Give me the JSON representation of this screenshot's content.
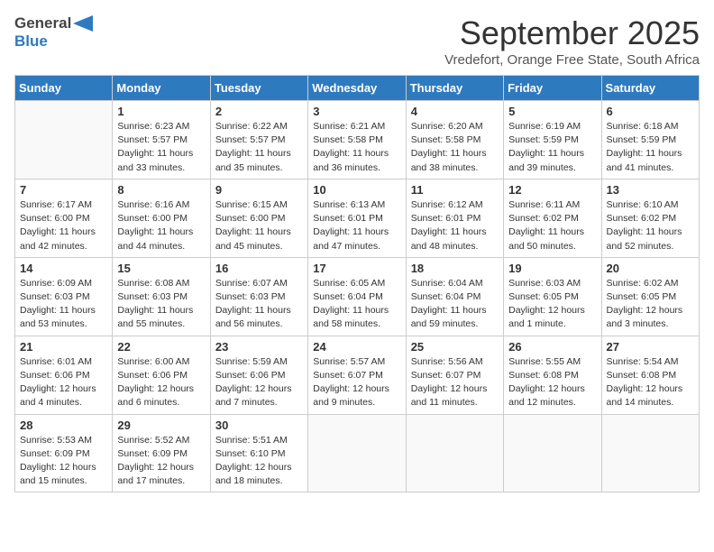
{
  "header": {
    "logo_general": "General",
    "logo_blue": "Blue",
    "month_title": "September 2025",
    "subtitle": "Vredefort, Orange Free State, South Africa"
  },
  "days_of_week": [
    "Sunday",
    "Monday",
    "Tuesday",
    "Wednesday",
    "Thursday",
    "Friday",
    "Saturday"
  ],
  "weeks": [
    [
      {
        "day": "",
        "info": ""
      },
      {
        "day": "1",
        "info": "Sunrise: 6:23 AM\nSunset: 5:57 PM\nDaylight: 11 hours\nand 33 minutes."
      },
      {
        "day": "2",
        "info": "Sunrise: 6:22 AM\nSunset: 5:57 PM\nDaylight: 11 hours\nand 35 minutes."
      },
      {
        "day": "3",
        "info": "Sunrise: 6:21 AM\nSunset: 5:58 PM\nDaylight: 11 hours\nand 36 minutes."
      },
      {
        "day": "4",
        "info": "Sunrise: 6:20 AM\nSunset: 5:58 PM\nDaylight: 11 hours\nand 38 minutes."
      },
      {
        "day": "5",
        "info": "Sunrise: 6:19 AM\nSunset: 5:59 PM\nDaylight: 11 hours\nand 39 minutes."
      },
      {
        "day": "6",
        "info": "Sunrise: 6:18 AM\nSunset: 5:59 PM\nDaylight: 11 hours\nand 41 minutes."
      }
    ],
    [
      {
        "day": "7",
        "info": "Sunrise: 6:17 AM\nSunset: 6:00 PM\nDaylight: 11 hours\nand 42 minutes."
      },
      {
        "day": "8",
        "info": "Sunrise: 6:16 AM\nSunset: 6:00 PM\nDaylight: 11 hours\nand 44 minutes."
      },
      {
        "day": "9",
        "info": "Sunrise: 6:15 AM\nSunset: 6:00 PM\nDaylight: 11 hours\nand 45 minutes."
      },
      {
        "day": "10",
        "info": "Sunrise: 6:13 AM\nSunset: 6:01 PM\nDaylight: 11 hours\nand 47 minutes."
      },
      {
        "day": "11",
        "info": "Sunrise: 6:12 AM\nSunset: 6:01 PM\nDaylight: 11 hours\nand 48 minutes."
      },
      {
        "day": "12",
        "info": "Sunrise: 6:11 AM\nSunset: 6:02 PM\nDaylight: 11 hours\nand 50 minutes."
      },
      {
        "day": "13",
        "info": "Sunrise: 6:10 AM\nSunset: 6:02 PM\nDaylight: 11 hours\nand 52 minutes."
      }
    ],
    [
      {
        "day": "14",
        "info": "Sunrise: 6:09 AM\nSunset: 6:03 PM\nDaylight: 11 hours\nand 53 minutes."
      },
      {
        "day": "15",
        "info": "Sunrise: 6:08 AM\nSunset: 6:03 PM\nDaylight: 11 hours\nand 55 minutes."
      },
      {
        "day": "16",
        "info": "Sunrise: 6:07 AM\nSunset: 6:03 PM\nDaylight: 11 hours\nand 56 minutes."
      },
      {
        "day": "17",
        "info": "Sunrise: 6:05 AM\nSunset: 6:04 PM\nDaylight: 11 hours\nand 58 minutes."
      },
      {
        "day": "18",
        "info": "Sunrise: 6:04 AM\nSunset: 6:04 PM\nDaylight: 11 hours\nand 59 minutes."
      },
      {
        "day": "19",
        "info": "Sunrise: 6:03 AM\nSunset: 6:05 PM\nDaylight: 12 hours\nand 1 minute."
      },
      {
        "day": "20",
        "info": "Sunrise: 6:02 AM\nSunset: 6:05 PM\nDaylight: 12 hours\nand 3 minutes."
      }
    ],
    [
      {
        "day": "21",
        "info": "Sunrise: 6:01 AM\nSunset: 6:06 PM\nDaylight: 12 hours\nand 4 minutes."
      },
      {
        "day": "22",
        "info": "Sunrise: 6:00 AM\nSunset: 6:06 PM\nDaylight: 12 hours\nand 6 minutes."
      },
      {
        "day": "23",
        "info": "Sunrise: 5:59 AM\nSunset: 6:06 PM\nDaylight: 12 hours\nand 7 minutes."
      },
      {
        "day": "24",
        "info": "Sunrise: 5:57 AM\nSunset: 6:07 PM\nDaylight: 12 hours\nand 9 minutes."
      },
      {
        "day": "25",
        "info": "Sunrise: 5:56 AM\nSunset: 6:07 PM\nDaylight: 12 hours\nand 11 minutes."
      },
      {
        "day": "26",
        "info": "Sunrise: 5:55 AM\nSunset: 6:08 PM\nDaylight: 12 hours\nand 12 minutes."
      },
      {
        "day": "27",
        "info": "Sunrise: 5:54 AM\nSunset: 6:08 PM\nDaylight: 12 hours\nand 14 minutes."
      }
    ],
    [
      {
        "day": "28",
        "info": "Sunrise: 5:53 AM\nSunset: 6:09 PM\nDaylight: 12 hours\nand 15 minutes."
      },
      {
        "day": "29",
        "info": "Sunrise: 5:52 AM\nSunset: 6:09 PM\nDaylight: 12 hours\nand 17 minutes."
      },
      {
        "day": "30",
        "info": "Sunrise: 5:51 AM\nSunset: 6:10 PM\nDaylight: 12 hours\nand 18 minutes."
      },
      {
        "day": "",
        "info": ""
      },
      {
        "day": "",
        "info": ""
      },
      {
        "day": "",
        "info": ""
      },
      {
        "day": "",
        "info": ""
      }
    ]
  ]
}
